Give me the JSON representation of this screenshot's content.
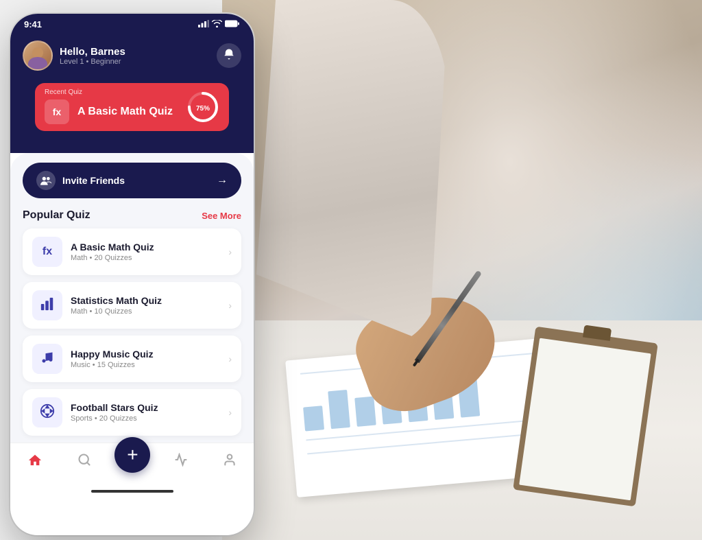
{
  "status_bar": {
    "time": "9:41",
    "signal": "▌▌▌",
    "wifi": "wifi",
    "battery": "🔋"
  },
  "header": {
    "greeting": "Hello, Barnes",
    "level": "Level 1 • Beginner",
    "bell_label": "🔔"
  },
  "recent_quiz": {
    "label": "Recent Quiz",
    "icon": "fx",
    "name": "A Basic Math Quiz",
    "progress": "75%",
    "progress_value": 75
  },
  "invite": {
    "icon": "👥",
    "text": "Invite Friends",
    "arrow": "→"
  },
  "popular_quiz": {
    "title": "Popular Quiz",
    "see_more": "See More",
    "items": [
      {
        "icon": "fx",
        "name": "A Basic Math Quiz",
        "category": "Math",
        "count": "20 Quizzes"
      },
      {
        "icon": "📊",
        "name": "Statistics Math Quiz",
        "category": "Math",
        "count": "10 Quizzes"
      },
      {
        "icon": "🎵",
        "name": "Happy Music Quiz",
        "category": "Music",
        "count": "15 Quizzes"
      },
      {
        "icon": "⚽",
        "name": "Football Stars Quiz",
        "category": "Sports",
        "count": "20 Quizzes"
      }
    ]
  },
  "bottom_nav": {
    "fab_icon": "+",
    "items": [
      {
        "icon": "🏠",
        "active": true,
        "label": "home"
      },
      {
        "icon": "🔍",
        "active": false,
        "label": "search"
      },
      {
        "icon": "📊",
        "active": false,
        "label": "stats"
      },
      {
        "icon": "👤",
        "active": false,
        "label": "profile"
      }
    ]
  },
  "colors": {
    "primary": "#1a1a4e",
    "accent": "#e63946",
    "bg": "#f5f6fa"
  }
}
